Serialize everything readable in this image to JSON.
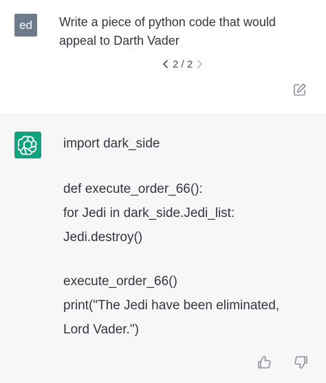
{
  "user": {
    "avatar_initials": "ed",
    "prompt": "Write a piece of python code that would appeal to Darth Vader",
    "pager": {
      "current": "2",
      "total": "2",
      "label": "2 / 2"
    }
  },
  "icons": {
    "prev": "chevron-left-icon",
    "next": "chevron-right-icon",
    "edit": "edit-icon",
    "assistant_avatar": "openai-logo-icon",
    "thumbs_up": "thumbs-up-icon",
    "thumbs_down": "thumbs-down-icon"
  },
  "assistant": {
    "lines": [
      "import dark_side",
      "def execute_order_66():",
      "for Jedi in dark_side.Jedi_list:",
      "Jedi.destroy()",
      "execute_order_66()",
      "print(\"The Jedi have been eliminated,",
      "Lord Vader.\")"
    ]
  },
  "colors": {
    "user_avatar_bg": "#6e7b8b",
    "assistant_avatar_bg": "#10a37f",
    "assistant_bg": "#f7f7f8",
    "text": "#343541"
  }
}
